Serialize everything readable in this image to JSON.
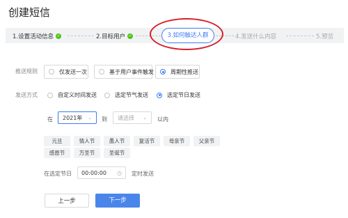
{
  "page": {
    "title": "创建短信"
  },
  "steps": [
    {
      "label": "1.设置活动信息",
      "state": "done"
    },
    {
      "label": "2.目标用户",
      "state": "done"
    },
    {
      "label": "3.如何触达人群",
      "state": "active"
    },
    {
      "label": "4.发送什么内容",
      "state": "todo"
    },
    {
      "label": "5.预览",
      "state": "todo"
    }
  ],
  "push_rule": {
    "label": "推送规则",
    "options": [
      "仅发送一次",
      "基于用户事件触发",
      "周期性推送"
    ],
    "selected": "周期性推送"
  },
  "send_method": {
    "label": "发送方式",
    "options": [
      "自定义时间发送",
      "选定节气发送",
      "选定节日发送"
    ],
    "selected": "选定节日发送"
  },
  "range": {
    "prefix": "在",
    "start_value": "2021年",
    "to": "到",
    "end_placeholder": "请选择",
    "suffix": "以内"
  },
  "holidays": [
    "元旦",
    "情人节",
    "愚人节",
    "复活节",
    "母亲节",
    "父亲节",
    "感恩节",
    "万圣节",
    "圣诞节"
  ],
  "time_row": {
    "label": "在选定节日",
    "value": "00:00:00",
    "suffix": "定时发送"
  },
  "buttons": {
    "prev": "上一步",
    "next": "下一步"
  },
  "colors": {
    "accent": "#3d7bf5",
    "success": "#52c41a",
    "annotation": "#d61f2a"
  }
}
